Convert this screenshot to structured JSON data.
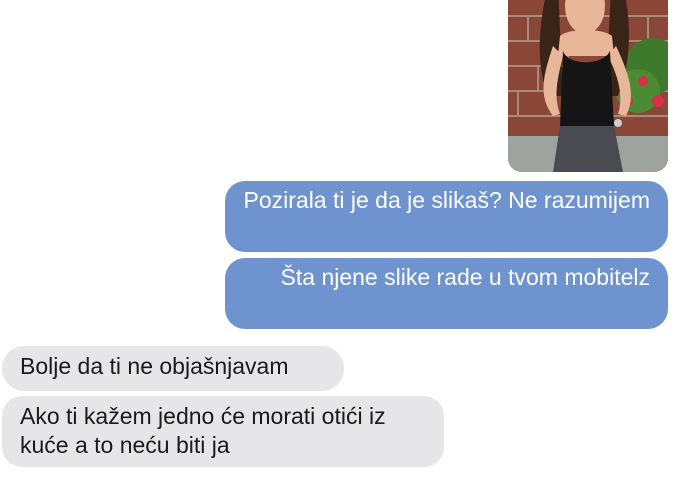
{
  "conversation": {
    "messages": [
      {
        "sender": "other",
        "type": "photo"
      },
      {
        "sender": "me",
        "text": "Pozirala ti je da je slikaš? Ne razumijem"
      },
      {
        "sender": "me",
        "text": "Šta njene slike rade u tvom mobitelz"
      },
      {
        "sender": "them",
        "text": "Bolje da ti ne objašnjavam"
      },
      {
        "sender": "them",
        "text": "Ako ti kažem jedno će morati otići iz kuće a to neću biti ja"
      }
    ]
  },
  "colors": {
    "sent_bubble": "#6f93cf",
    "received_bubble": "#e6e6e9",
    "background": "#ffffff"
  }
}
